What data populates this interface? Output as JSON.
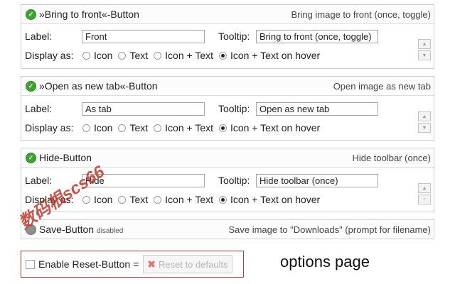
{
  "labels": {
    "label": "Label:",
    "tooltip": "Tooltip:",
    "display_as": "Display as:"
  },
  "display_options": [
    "Icon",
    "Text",
    "Icon + Text",
    "Icon + Text on hover"
  ],
  "panels": [
    {
      "title": "»Bring to front«-Button",
      "description": "Bring image to front (once, toggle)",
      "label_value": "Front",
      "tooltip_value": "Bring to front (once, toggle)",
      "selected": "Icon + Text on hover",
      "enabled": true
    },
    {
      "title": "»Open as new tab«-Button",
      "description": "Open image as new tab",
      "label_value": "As tab",
      "tooltip_value": "Open as new tab",
      "selected": "Icon + Text on hover",
      "enabled": true
    },
    {
      "title": "Hide-Button",
      "description": "Hide toolbar (once)",
      "label_value": "Hide",
      "tooltip_value": "Hide toolbar (once)",
      "selected": "Icon + Text on hover",
      "enabled": true
    },
    {
      "title": "Save-Button",
      "badge": "disabled",
      "description": "Save image to \"Downloads\" (prompt for filename)",
      "enabled": false
    }
  ],
  "reset": {
    "checkbox_label": "Enable Reset-Button =",
    "button_label": "Reset to defaults",
    "checked": false
  },
  "caption": "options page",
  "watermark": "数码根scs66",
  "colors": {
    "enabled_icon": "#3aa52f",
    "disabled_icon": "#8f8f8f",
    "reset_border": "#c0392b"
  }
}
